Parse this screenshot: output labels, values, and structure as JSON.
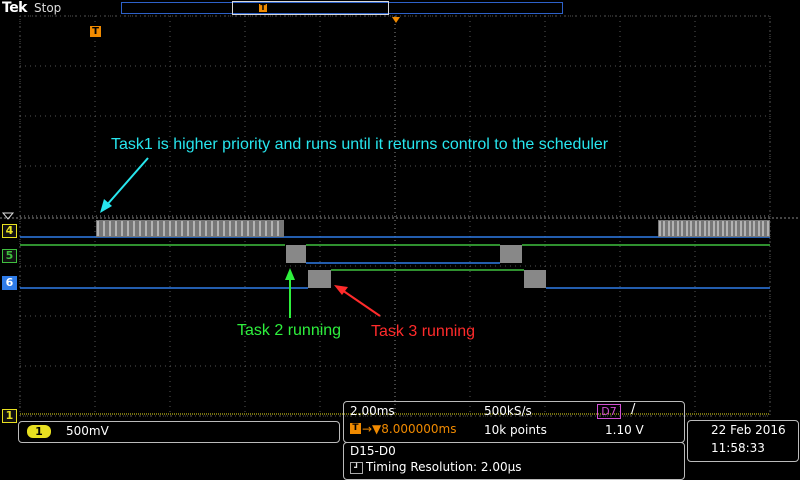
{
  "header": {
    "brand": "Tek",
    "status": "Stop",
    "trigger_marker": "T"
  },
  "annotations": {
    "task1": "Task1 is higher priority and runs until it returns control to the scheduler",
    "task2": "Task 2 running",
    "task3": "Task 3 running"
  },
  "channels": {
    "d4": "4",
    "d5": "5",
    "d6": "6",
    "ch1": "1"
  },
  "ch1_panel": {
    "badge": "1",
    "scale": "500mV"
  },
  "acquisition": {
    "horizontal_scale": "2.00ms",
    "sample_rate": "500kS/s",
    "trigger_source": "D7",
    "trigger_slope": "/",
    "trigger_position": "→▼8.000000ms",
    "record_length": "10k points",
    "trigger_level": "1.10 V"
  },
  "digital": {
    "group": "D15-D0",
    "timing_resolution": "Timing Resolution: 2.00µs"
  },
  "clock": {
    "date": "22 Feb  2016",
    "time": "11:58:33"
  },
  "colors": {
    "d4": "#e8e020",
    "d5": "#3fbf3f",
    "d6": "#2f7ce8",
    "trigger": "#f08a00",
    "task1_text": "#27e6ee",
    "task2_text": "#2ef03d",
    "task3_text": "#ff2b2b"
  }
}
